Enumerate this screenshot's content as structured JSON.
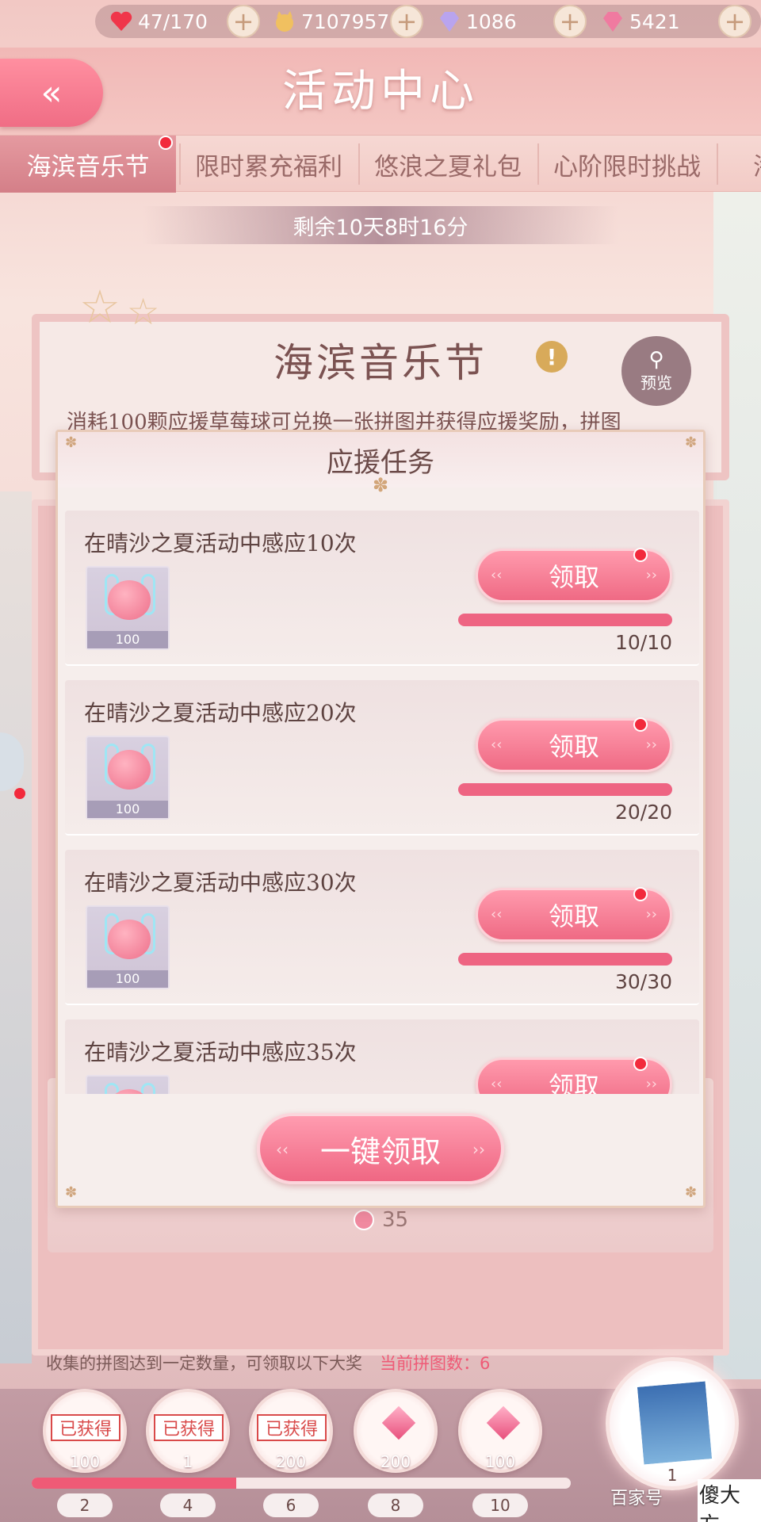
{
  "resources": [
    {
      "icon": "heart-icon",
      "value": "47/170",
      "color": "#f0364a"
    },
    {
      "icon": "cat-coin-icon",
      "value": "7107957",
      "color": "#f0c060"
    },
    {
      "icon": "diamond-icon",
      "value": "1086",
      "color": "#b9a4ee"
    },
    {
      "icon": "pink-gem-icon",
      "value": "5421",
      "color": "#f07aa0"
    }
  ],
  "header": {
    "title": "活动中心",
    "back_label": "«"
  },
  "tabs": [
    "海滨音乐节",
    "限时累充福利",
    "悠浪之夏礼包",
    "心阶限时挑战",
    "海"
  ],
  "timer": "剩余10天8时16分",
  "event": {
    "title": "海滨音乐节",
    "description": "消耗100颗应援草莓球可兑换一张拼图并获得应援奖励，拼图",
    "preview_label": "预览"
  },
  "modal": {
    "title": "应援任务",
    "claim_all_label": "一键领取"
  },
  "tasks": [
    {
      "label": "在晴沙之夏活动中感应10次",
      "reward_qty": "100",
      "button": "领取",
      "progress_text": "10/10",
      "progress": 1.0
    },
    {
      "label": "在晴沙之夏活动中感应20次",
      "reward_qty": "100",
      "button": "领取",
      "progress_text": "20/20",
      "progress": 1.0
    },
    {
      "label": "在晴沙之夏活动中感应30次",
      "reward_qty": "100",
      "button": "领取",
      "progress_text": "30/30",
      "progress": 1.0
    },
    {
      "label": "在晴沙之夏活动中感应35次",
      "reward_qty": "",
      "button": "领取",
      "progress_text": "",
      "progress": 1.0
    }
  ],
  "ball_count": "35",
  "collect": {
    "text": "收集的拼图达到一定数量，可领取以下大奖",
    "current_label": "当前拼图数：6"
  },
  "milestones": [
    {
      "stamp": "已获得",
      "amount": "100",
      "target": "2"
    },
    {
      "stamp": "已获得",
      "amount": "1",
      "target": "4"
    },
    {
      "stamp": "已获得",
      "amount": "200",
      "target": "6"
    },
    {
      "stamp": "",
      "amount": "200",
      "target": "8"
    },
    {
      "stamp": "",
      "amount": "100",
      "target": "10"
    }
  ],
  "milestone_progress": 0.38,
  "grand_prize": {
    "amount": "1"
  },
  "watermark": {
    "left": "百家号",
    "right": "傻大方"
  }
}
